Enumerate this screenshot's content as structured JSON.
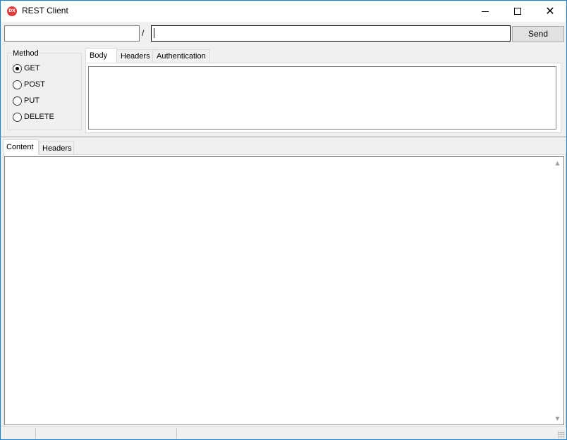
{
  "window": {
    "title": "REST Client",
    "icon": "dx-app-icon",
    "controls": {
      "minimize": "minimize-icon",
      "maximize": "maximize-icon",
      "close": "✕"
    }
  },
  "request": {
    "host_value": "",
    "separator": "/",
    "path_value": "",
    "send_label": "Send"
  },
  "method": {
    "legend": "Method",
    "options": [
      {
        "label": "GET",
        "checked": true
      },
      {
        "label": "POST",
        "checked": false
      },
      {
        "label": "PUT",
        "checked": false
      },
      {
        "label": "DELETE",
        "checked": false
      }
    ]
  },
  "request_tabs": [
    {
      "label": "Body",
      "active": true
    },
    {
      "label": "Headers",
      "active": false
    },
    {
      "label": "Authentication",
      "active": false
    }
  ],
  "response_tabs": [
    {
      "label": "Content",
      "active": true
    },
    {
      "label": "Headers",
      "active": false
    }
  ],
  "scrollbar": {
    "up": "▲",
    "down": "▼"
  }
}
